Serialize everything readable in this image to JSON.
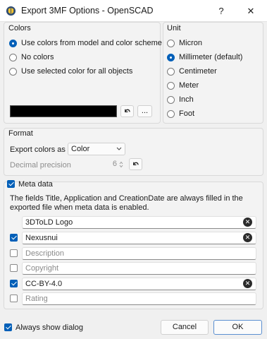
{
  "window": {
    "title": "Export 3MF Options - OpenSCAD",
    "help_label": "?",
    "close_label": "✕"
  },
  "colors": {
    "group_title": "Colors",
    "options": [
      {
        "label": "Use colors from model and color scheme",
        "checked": true
      },
      {
        "label": "No colors",
        "checked": false
      },
      {
        "label": "Use selected color for all objects",
        "checked": false
      }
    ],
    "swatch_color": "#000000",
    "reset_icon": "undo-icon",
    "more_label": "..."
  },
  "unit": {
    "group_title": "Unit",
    "options": [
      {
        "label": "Micron",
        "checked": false
      },
      {
        "label": "Millimeter (default)",
        "checked": true
      },
      {
        "label": "Centimeter",
        "checked": false
      },
      {
        "label": "Meter",
        "checked": false
      },
      {
        "label": "Inch",
        "checked": false
      },
      {
        "label": "Foot",
        "checked": false
      }
    ]
  },
  "format": {
    "group_title": "Format",
    "export_colors_label": "Export colors as",
    "export_colors_value": "Color",
    "decimal_label": "Decimal precision",
    "decimal_value": "6"
  },
  "meta": {
    "label": "Meta data",
    "checked": true,
    "description": "The fields Title, Application and CreationDate are always filled in the exported file when meta data is enabled.",
    "fields": [
      {
        "value": "3DToLD Logo",
        "placeholder": "",
        "has_checkbox": false,
        "checked": false,
        "clearable": true
      },
      {
        "value": "Nexusnui",
        "placeholder": "",
        "has_checkbox": true,
        "checked": true,
        "clearable": true
      },
      {
        "value": "",
        "placeholder": "Description",
        "has_checkbox": true,
        "checked": false,
        "clearable": false
      },
      {
        "value": "",
        "placeholder": "Copyright",
        "has_checkbox": true,
        "checked": false,
        "clearable": false
      },
      {
        "value": "CC-BY-4.0",
        "placeholder": "",
        "has_checkbox": true,
        "checked": true,
        "clearable": true
      },
      {
        "value": "",
        "placeholder": "Rating",
        "has_checkbox": true,
        "checked": false,
        "clearable": false
      }
    ]
  },
  "footer": {
    "always_show_label": "Always show dialog",
    "always_show_checked": true,
    "cancel_label": "Cancel",
    "ok_label": "OK"
  },
  "accent_color": "#005fb8"
}
